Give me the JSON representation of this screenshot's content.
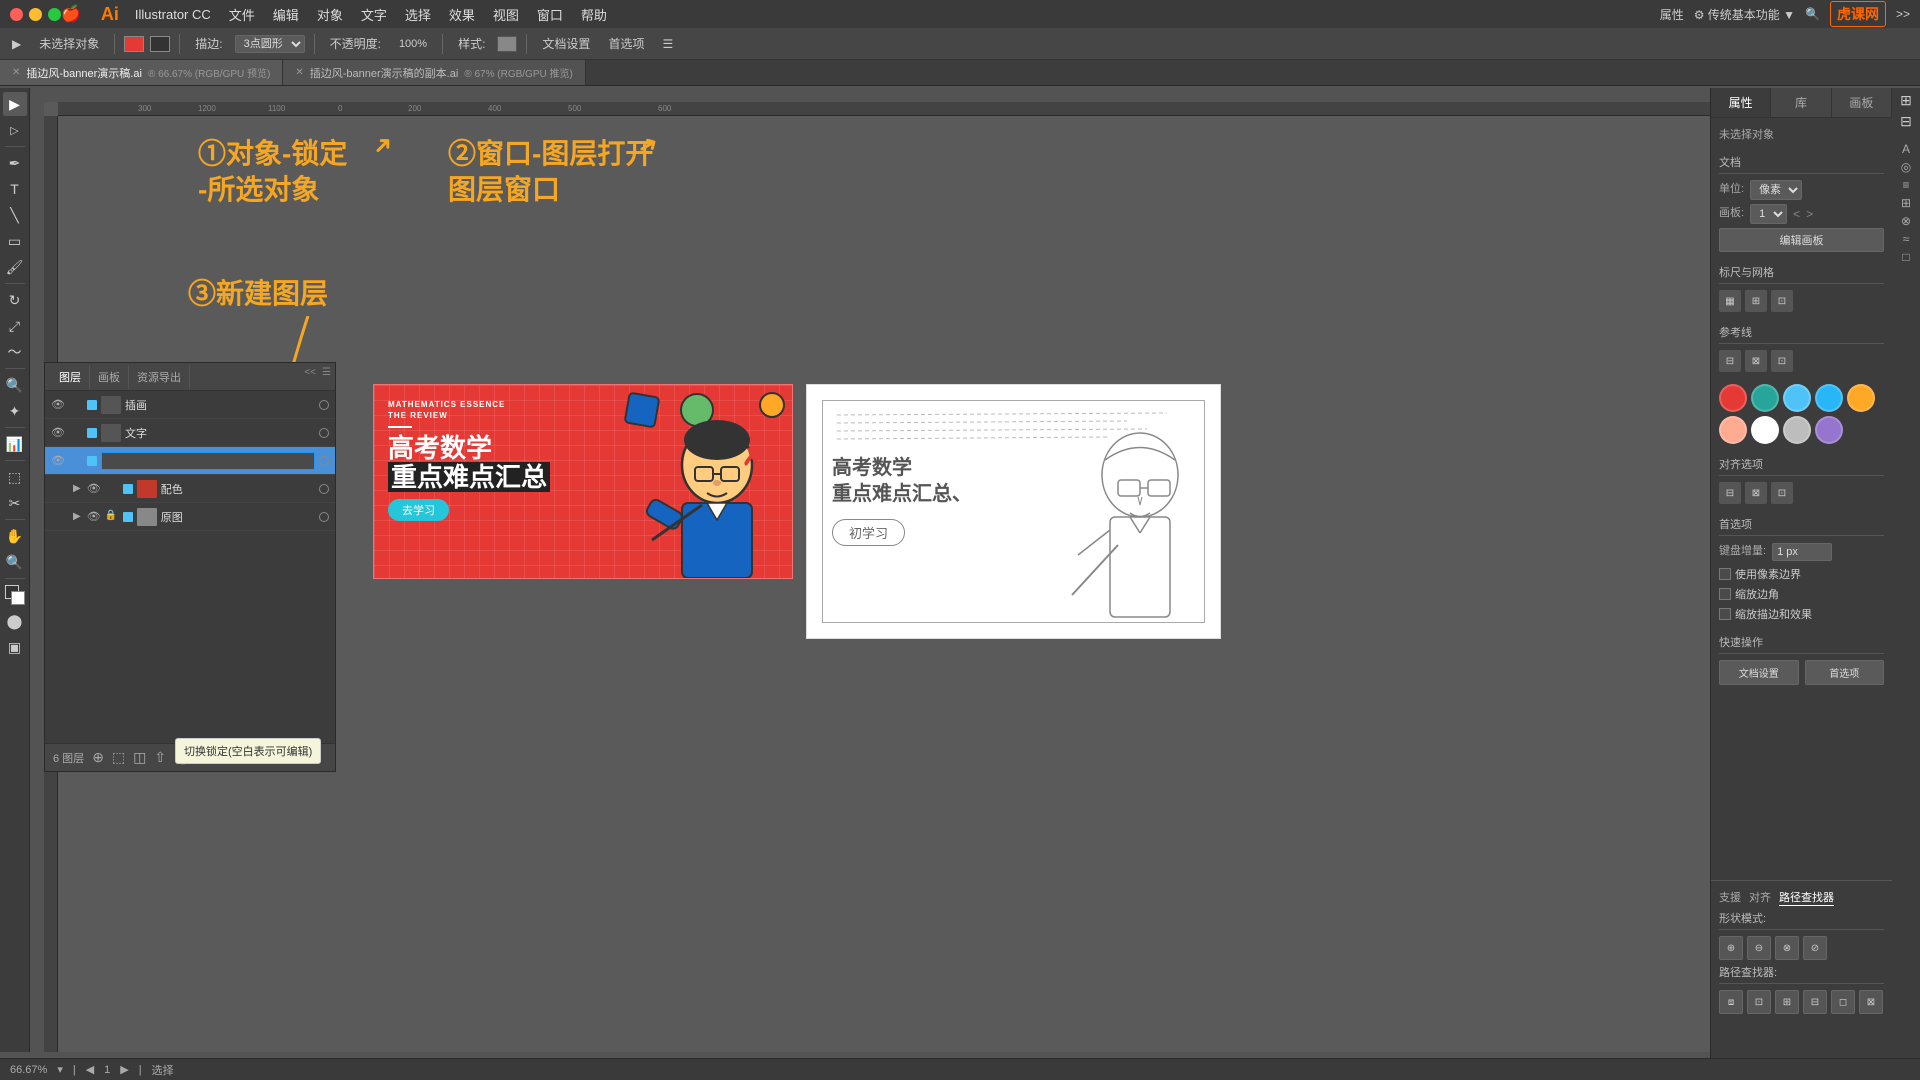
{
  "titlebar": {
    "apple": "🍎",
    "app_name": "Illustrator CC",
    "menus": [
      "文件",
      "编辑",
      "对象",
      "文字",
      "选择",
      "效果",
      "视图",
      "窗口",
      "帮助"
    ],
    "ai_logo": "Ai",
    "right_label": "传统基本功能",
    "brand": "虎课网"
  },
  "toolbar": {
    "no_selection": "未选择对象",
    "stroke_label": "描边:",
    "stroke_option": "3点圆形",
    "opacity_label": "不透明度:",
    "opacity_value": "100%",
    "style_label": "样式:",
    "doc_settings": "文档设置",
    "preferences": "首选项"
  },
  "tabs": [
    {
      "name": "插边风-banner演示稿.ai",
      "zoom": "66.67%",
      "mode": "RGB/GPU 预览",
      "active": true
    },
    {
      "name": "插边风-banner演示稿的副本.ai",
      "zoom": "67%",
      "mode": "RGB/GPU 推览",
      "active": false
    }
  ],
  "annotations": {
    "ann1": "①对象-锁定\n-所选对象",
    "ann2": "②窗口-图层打开\n图层窗口",
    "ann3": "③新建图层"
  },
  "layers_panel": {
    "tabs": [
      "图层",
      "画板",
      "资源导出"
    ],
    "layers": [
      {
        "name": "插画",
        "color": "#4fc3f7",
        "visible": true,
        "locked": false,
        "indent": 0
      },
      {
        "name": "文字",
        "color": "#4fc3f7",
        "visible": true,
        "locked": false,
        "indent": 0
      },
      {
        "name": "",
        "color": "#4fc3f7",
        "visible": true,
        "locked": false,
        "indent": 0,
        "editing": true
      },
      {
        "name": "配色",
        "color": "#4fc3f7",
        "visible": true,
        "locked": false,
        "indent": 1
      },
      {
        "name": "原图",
        "color": "#4fc3f7",
        "visible": true,
        "locked": true,
        "indent": 1
      }
    ],
    "layer_count": "6 图层",
    "tooltip": "切换锁定(空白表示可编辑)"
  },
  "right_panel": {
    "tabs": [
      "属性",
      "库",
      "画板"
    ],
    "title": "未选择对象",
    "doc_section": "文档",
    "unit_label": "单位:",
    "unit_value": "像素",
    "artboard_label": "画板:",
    "artboard_value": "1",
    "edit_artboard_btn": "编辑画板",
    "rulers_label": "标尺与网格",
    "guides_label": "参考线",
    "align_label": "对齐选项",
    "preferences_label": "首选项",
    "keyboard_nudge": "键盘增量:",
    "nudge_value": "1 px",
    "snap_pixel_cb": "使用像素边界",
    "snap_corner_cb": "缩放边角",
    "raster_cb": "缩放描边和效果",
    "quick_actions": "快速操作",
    "doc_settings_btn": "文档设置",
    "preferences_btn": "首选项",
    "colors": [
      "#e53935",
      "#26a69a",
      "#4fc3f7",
      "#29b6f6",
      "#ffa726",
      "#ffab91",
      "#ffffff",
      "#bdbdbd",
      "#9575cd"
    ],
    "path_finder_label": "路径查找器",
    "shape_modes_label": "形状模式:",
    "path_finder_label2": "路径查找器:",
    "transform_label": "支援",
    "align_panel_label": "对齐",
    "path_panel_label": "路径查找器"
  },
  "status_bar": {
    "zoom": "66.67%",
    "artboard": "1",
    "tool": "选择"
  },
  "banner": {
    "top_text1": "MATHEMATICS ESSENCE",
    "top_text2": "THE REVIEW",
    "title_line1": "高考数学",
    "title_line2": "重点难点汇总",
    "btn_text": "去学习"
  }
}
